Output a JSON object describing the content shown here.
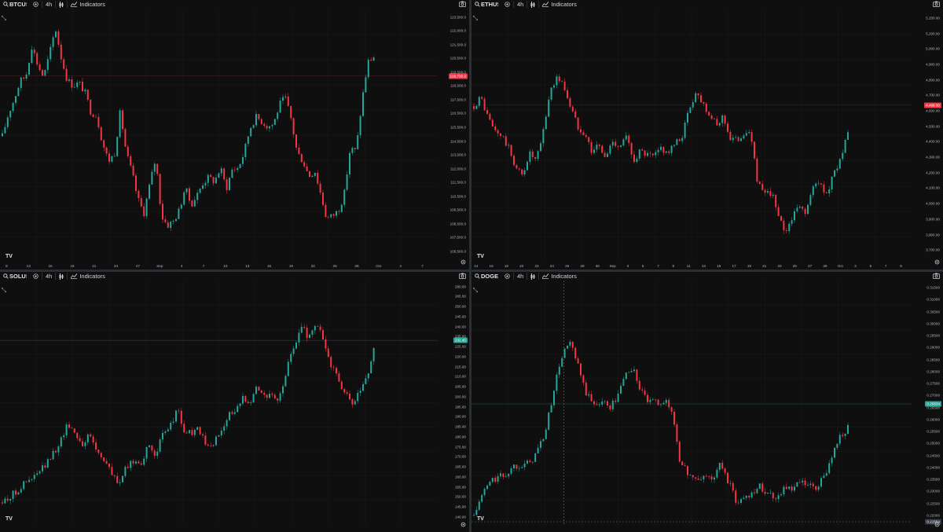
{
  "colors": {
    "up": "#26a69a",
    "down": "#f23645",
    "bg": "#0f0f0f",
    "grid": "#1c1c1c",
    "text": "#b2b5be"
  },
  "common": {
    "indicators_label": "Indicators",
    "tv_logo": "TV"
  },
  "panes": [
    {
      "symbol": "BTCUS",
      "interval": "4h",
      "icons": [
        "search-icon",
        "add-symbol-icon",
        "candles-icon",
        "indicators-icon",
        "camera-icon",
        "expand-icon",
        "gear-icon"
      ],
      "y_labels": [
        "123,500.0",
        "122,000.0",
        "121,500.0",
        "120,500.0",
        "119,500.0",
        "118,500.0",
        "117,500.0",
        "116,500.0",
        "115,500.0",
        "114,500.0",
        "113,500.0",
        "112,500.0",
        "111,500.0",
        "110,500.0",
        "109,500.0",
        "108,500.0",
        "107,500.0",
        "106,500.0"
      ],
      "last_price": "120,735.0",
      "last_price_up": false,
      "x_labels": [
        "8",
        "13",
        "15",
        "18",
        "21",
        "24",
        "27",
        "Sep",
        "4",
        "7",
        "10",
        "13",
        "16",
        "19",
        "22",
        "25",
        "28",
        "Oct",
        "4",
        "7"
      ],
      "series": [
        115.2,
        116.8,
        117.9,
        119.2,
        119.6,
        121.8,
        120.4,
        119.5,
        121.2,
        123.1,
        120.9,
        119.3,
        118.9,
        119.1,
        118.4,
        117.0,
        116.7,
        114.7,
        113.4,
        113.9,
        117.0,
        114.0,
        112.5,
        110.6,
        109.6,
        111.7,
        113.6,
        109.4,
        108.7,
        109.0,
        109.8,
        111.5,
        110.2,
        110.9,
        111.8,
        112.2,
        111.9,
        112.9,
        111.4,
        112.8,
        112.9,
        114.0,
        115.8,
        116.6,
        116.3,
        115.9,
        116.1,
        117.5,
        118.0,
        116.4,
        114.0,
        113.4,
        112.3,
        112.7,
        111.0,
        109.2,
        109.4,
        109.8,
        111.0,
        114.3,
        114.1,
        117.8,
        120.6,
        121.0
      ],
      "ymin": 106.0,
      "ymax": 124.5,
      "ref_frac": 0.265
    },
    {
      "symbol": "ETHUS",
      "interval": "4h",
      "icons": [
        "search-icon",
        "add-symbol-icon",
        "candles-icon",
        "indicators-icon",
        "camera-icon",
        "expand-icon",
        "gear-icon"
      ],
      "y_labels": [
        "5,250.00",
        "5,200.00",
        "5,000.00",
        "4,900.00",
        "4,800.00",
        "4,700.00",
        "4,600.00",
        "4,500.00",
        "4,400.00",
        "4,300.00",
        "4,200.00",
        "4,100.00",
        "4,000.00",
        "3,900.00",
        "3,800.00",
        "3,700.00"
      ],
      "last_price": "4,468.00",
      "last_price_up": false,
      "x_labels": [
        "14",
        "16",
        "18",
        "20",
        "22",
        "24",
        "26",
        "28",
        "30",
        "Sep",
        "3",
        "5",
        "7",
        "9",
        "11",
        "13",
        "15",
        "17",
        "19",
        "21",
        "23",
        "25",
        "27",
        "29",
        "Oct",
        "3",
        "5",
        "7",
        "9"
      ],
      "series": [
        4650,
        4710,
        4580,
        4490,
        4460,
        4380,
        4260,
        4200,
        4350,
        4290,
        4480,
        4750,
        4840,
        4780,
        4640,
        4520,
        4480,
        4360,
        4400,
        4310,
        4430,
        4390,
        4450,
        4300,
        4360,
        4330,
        4320,
        4380,
        4350,
        4400,
        4450,
        4620,
        4740,
        4680,
        4600,
        4520,
        4590,
        4440,
        4430,
        4480,
        4460,
        4150,
        4070,
        4100,
        3920,
        3840,
        3940,
        4000,
        3970,
        4130,
        4150,
        4080,
        4220,
        4330,
        4460
      ],
      "ymin": 3640,
      "ymax": 5280,
      "ref_frac": 0.38
    },
    {
      "symbol": "SOLUS",
      "interval": "4h",
      "icons": [
        "search-icon",
        "add-symbol-icon",
        "candles-icon",
        "indicators-icon",
        "camera-icon",
        "expand-icon",
        "gear-icon"
      ],
      "y_labels": [
        "280.00",
        "265.00",
        "250.00",
        "245.00",
        "240.00",
        "235.00",
        "225.00",
        "220.00",
        "215.00",
        "210.00",
        "205.00",
        "200.00",
        "195.00",
        "190.00",
        "185.00",
        "180.00",
        "175.00",
        "170.00",
        "165.00",
        "160.00",
        "155.00",
        "150.00",
        "145.00",
        "140.00"
      ],
      "last_price": "232.45",
      "last_price_up": true,
      "x_labels": [],
      "series": [
        150,
        153,
        156,
        160,
        162,
        166,
        170,
        176,
        183,
        192,
        187,
        181,
        186,
        177,
        173,
        165,
        160,
        168,
        172,
        171,
        179,
        176,
        185,
        190,
        200,
        187,
        187,
        189,
        179,
        181,
        188,
        197,
        197,
        206,
        204,
        212,
        207,
        206,
        204,
        220,
        232,
        244,
        238,
        245,
        238,
        224,
        217,
        208,
        202,
        208,
        216,
        232
      ],
      "ymin": 138,
      "ymax": 268,
      "ref_frac": 0.245
    },
    {
      "symbol": "DOGE",
      "interval": "4h",
      "icons": [
        "search-icon",
        "add-symbol-icon",
        "candles-icon",
        "indicators-icon",
        "camera-icon",
        "expand-icon",
        "gear-icon"
      ],
      "y_labels": [
        "0.31500",
        "0.31000",
        "0.30500",
        "0.30000",
        "0.29500",
        "0.29000",
        "0.28500",
        "0.28000",
        "0.27500",
        "0.27000",
        "0.26500",
        "0.26000",
        "0.25500",
        "0.25000",
        "0.24500",
        "0.24000",
        "0.23500",
        "0.23000",
        "0.22500",
        "0.22000"
      ],
      "last_price": "0.25834",
      "last_price_up": true,
      "bottom_price": "0.21584",
      "x_labels": [],
      "series": [
        0.213,
        0.222,
        0.228,
        0.23,
        0.231,
        0.235,
        0.236,
        0.236,
        0.242,
        0.25,
        0.268,
        0.283,
        0.29,
        0.28,
        0.268,
        0.262,
        0.264,
        0.261,
        0.265,
        0.276,
        0.278,
        0.268,
        0.263,
        0.263,
        0.264,
        0.258,
        0.235,
        0.232,
        0.228,
        0.231,
        0.229,
        0.236,
        0.228,
        0.219,
        0.221,
        0.224,
        0.226,
        0.223,
        0.221,
        0.226,
        0.224,
        0.228,
        0.226,
        0.225,
        0.23,
        0.24,
        0.248,
        0.252
      ],
      "ymin": 0.209,
      "ymax": 0.317,
      "ref_frac": 0.505
    }
  ]
}
